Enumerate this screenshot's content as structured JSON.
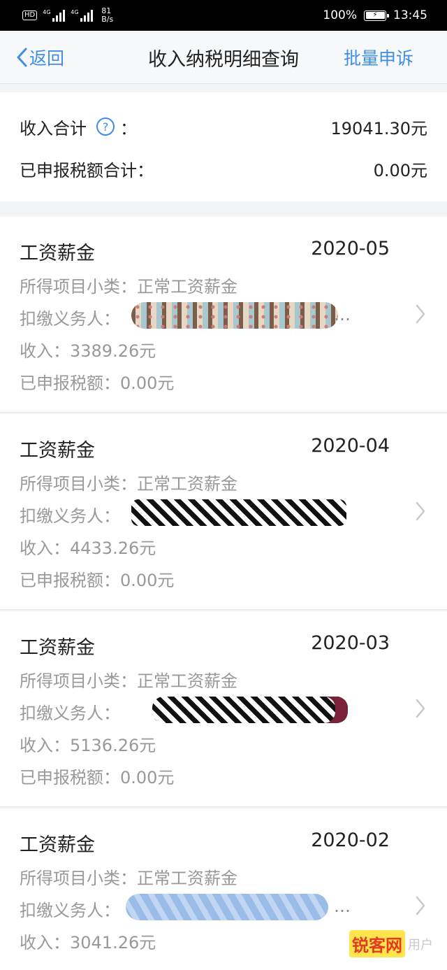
{
  "status_bar": {
    "hd_label": "HD",
    "signal1_tag": "4G",
    "signal2_tag": "4G",
    "speed_value": "81",
    "speed_unit": "B/s",
    "battery": "100%",
    "time": "13:45"
  },
  "nav": {
    "back_label": "返回",
    "title": "收入纳税明细查询",
    "action_label": "批量申诉"
  },
  "summary": {
    "income_label": "收入合计",
    "income_colon": "：",
    "income_value": "19041.30元",
    "tax_label": "已申报税额合计：",
    "tax_value": "0.00元"
  },
  "records": [
    {
      "title": "工资薪金",
      "date": "2020-05",
      "subcategory": "所得项目小类：正常工资薪金",
      "withholder_label": "扣缴义务人：",
      "income": "收入：3389.26元",
      "tax": "已申报税额：0.00元"
    },
    {
      "title": "工资薪金",
      "date": "2020-04",
      "subcategory": "所得项目小类：正常工资薪金",
      "withholder_label": "扣缴义务人：",
      "income": "收入：4433.26元",
      "tax": "已申报税额：0.00元"
    },
    {
      "title": "工资薪金",
      "date": "2020-03",
      "subcategory": "所得项目小类：正常工资薪金",
      "withholder_label": "扣缴义务人：",
      "income": "收入：5136.26元",
      "tax": "已申报税额：0.00元"
    },
    {
      "title": "工资薪金",
      "date": "2020-02",
      "subcategory": "所得项目小类：正常工资薪金",
      "withholder_label": "扣缴义务人：",
      "income": "收入：3041.26元"
    }
  ],
  "ellipsis": "…",
  "watermark": {
    "brand": "锐客网",
    "tail": "用户"
  },
  "colors": {
    "accent": "#3f8ee6",
    "secondary_text": "#999999",
    "background": "#f2f3f5"
  },
  "icons": {
    "back": "chevron-left-icon",
    "help": "question-circle-icon",
    "row_arrow": "chevron-right-icon"
  }
}
